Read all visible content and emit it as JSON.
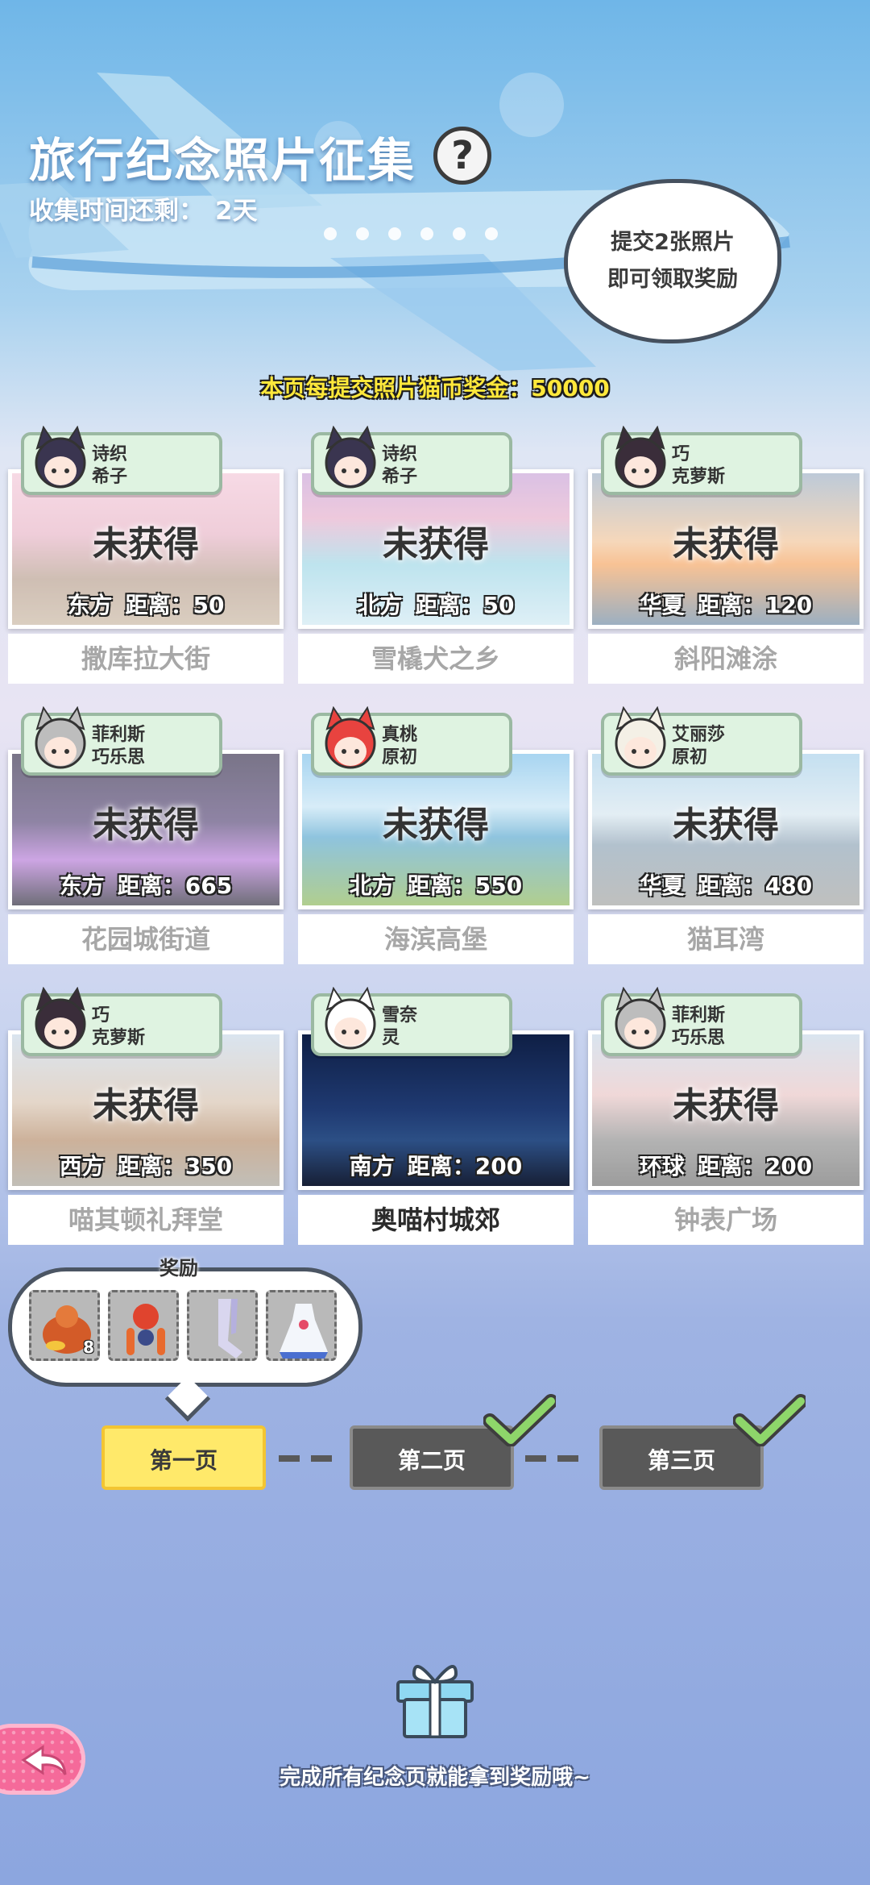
{
  "header": {
    "title": "旅行纪念照片征集",
    "help_icon": "?",
    "countdown_label": "收集时间还剩：",
    "countdown_value": "2天"
  },
  "bubble": {
    "line1": "提交2张照片",
    "line2": "即可领取奖励"
  },
  "bonus_text": "本页每提交照片猫币奖金：50000",
  "cards": [
    {
      "tag_line1": "诗织",
      "tag_line2": "希子",
      "status": "未获得",
      "direction": "东方",
      "distance": "距离：50",
      "name": "撒库拉大街"
    },
    {
      "tag_line1": "诗织",
      "tag_line2": "希子",
      "status": "未获得",
      "direction": "北方",
      "distance": "距离：50",
      "name": "雪橇犬之乡"
    },
    {
      "tag_line1": "巧",
      "tag_line2": "克萝斯",
      "status": "未获得",
      "direction": "华夏",
      "distance": "距离：120",
      "name": "斜阳滩涂"
    },
    {
      "tag_line1": "菲利斯",
      "tag_line2": "巧乐思",
      "status": "未获得",
      "direction": "东方",
      "distance": "距离：665",
      "name": "花园城街道"
    },
    {
      "tag_line1": "真桃",
      "tag_line2": "原初",
      "status": "未获得",
      "direction": "北方",
      "distance": "距离：550",
      "name": "海滨高堡"
    },
    {
      "tag_line1": "艾丽莎",
      "tag_line2": "原初",
      "status": "未获得",
      "direction": "华夏",
      "distance": "距离：480",
      "name": "猫耳湾"
    },
    {
      "tag_line1": "巧",
      "tag_line2": "克萝斯",
      "status": "未获得",
      "direction": "西方",
      "distance": "距离：350",
      "name": "喵其顿礼拜堂"
    },
    {
      "tag_line1": "雪奈",
      "tag_line2": "灵",
      "status": "",
      "direction": "南方",
      "distance": "距离：200",
      "name": "奥喵村城郊"
    },
    {
      "tag_line1": "菲利斯",
      "tag_line2": "巧乐思",
      "status": "未获得",
      "direction": "环球",
      "distance": "距离：200",
      "name": "钟表广场"
    }
  ],
  "reward": {
    "label": "奖励",
    "items": [
      {
        "icon": "coin-sack-icon",
        "count": "8"
      },
      {
        "icon": "lantern-ornament-icon",
        "count": ""
      },
      {
        "icon": "stockings-icon",
        "count": ""
      },
      {
        "icon": "dress-icon",
        "count": ""
      }
    ]
  },
  "pages": {
    "page1": "第一页",
    "page2": "第二页",
    "page3": "第三页"
  },
  "footer_hint": "完成所有纪念页就能拿到奖励哦~",
  "colors": {
    "accent_yellow": "#ffe96a",
    "tag_green": "#dff3e1",
    "check_green": "#8ed66a",
    "back_pink": "#f56a9a"
  }
}
